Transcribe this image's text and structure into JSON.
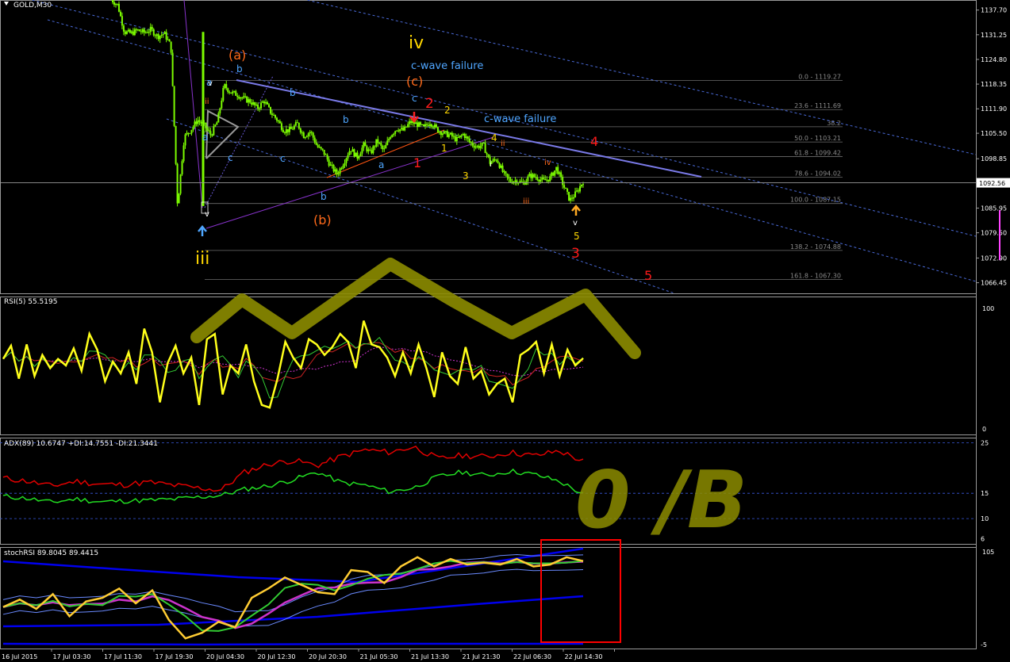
{
  "chart_title": "GOLD,M30",
  "colors": {
    "background": "#000000",
    "candles": "#7CFC00",
    "grid": "#1c3c5a",
    "separator": "#9a9a9a",
    "fib": "#6e6e6e",
    "wave_blue": "#4fa6ff",
    "wave_orange": "#ff6a1a",
    "wave_red": "#ff1a1a",
    "wave_yellow": "#ffd700",
    "channel": "#7a7ae8",
    "drawing_olive": "#8c8c00",
    "rsi": "#ffff1a",
    "adx_minus": "#e00000",
    "adx_plus": "#22dd22",
    "stoch_main": "#ffcc33",
    "stoch_signal": "#cc33cc",
    "box": "#ff0000"
  },
  "price_axis": {
    "ticks": [
      "1137.70",
      "1131.25",
      "1124.80",
      "1118.35",
      "1111.90",
      "1105.50",
      "1098.85",
      "1092.40",
      "1085.95",
      "1079.50",
      "1072.90",
      "1066.45"
    ],
    "current_price": "1092.56"
  },
  "fib_levels": [
    {
      "label": "0.0 - 1119.27"
    },
    {
      "label": "23.6 - 1111.69"
    },
    {
      "label": "38.2"
    },
    {
      "label": "50.0 - 1103.21"
    },
    {
      "label": "61.8 - 1099.42"
    },
    {
      "label": "78.6 - 1094.02"
    },
    {
      "label": "100.0 - 1087.15"
    },
    {
      "label": "138.2 - 1074.88"
    },
    {
      "label": "161.8 - 1067.30"
    }
  ],
  "wave_labels": [
    {
      "text": "iv",
      "color": "yellow",
      "size": 22
    },
    {
      "text": "iii",
      "color": "yellow",
      "size": 22
    },
    {
      "text": "(a)",
      "color": "orange",
      "size": 16
    },
    {
      "text": "(b)",
      "color": "orange",
      "size": 16
    },
    {
      "text": "(c)",
      "color": "orange",
      "size": 16
    },
    {
      "text": "c-wave failure",
      "color": "blue",
      "size": 13
    },
    {
      "text": "c-wave failure",
      "color": "blue",
      "size": 13
    },
    {
      "text": "a",
      "color": "blue",
      "size": 12
    },
    {
      "text": "b",
      "color": "blue",
      "size": 12
    },
    {
      "text": "c",
      "color": "blue",
      "size": 12
    },
    {
      "text": "a",
      "color": "blue",
      "size": 12
    },
    {
      "text": "b",
      "color": "blue",
      "size": 12
    },
    {
      "text": "c",
      "color": "blue",
      "size": 12
    },
    {
      "text": "b",
      "color": "blue",
      "size": 12
    },
    {
      "text": "a",
      "color": "blue",
      "size": 12
    },
    {
      "text": "b",
      "color": "blue",
      "size": 12
    },
    {
      "text": "c",
      "color": "blue",
      "size": 12
    },
    {
      "text": "1",
      "color": "red",
      "size": 16
    },
    {
      "text": "2",
      "color": "red",
      "size": 17
    },
    {
      "text": "3",
      "color": "red",
      "size": 17
    },
    {
      "text": "4",
      "color": "red",
      "size": 16
    },
    {
      "text": "5",
      "color": "red",
      "size": 16
    },
    {
      "text": "1",
      "color": "yellow",
      "size": 12
    },
    {
      "text": "2",
      "color": "yellow",
      "size": 12
    },
    {
      "text": "3",
      "color": "yellow",
      "size": 12
    },
    {
      "text": "4",
      "color": "yellow",
      "size": 12
    },
    {
      "text": "5",
      "color": "yellow",
      "size": 12
    },
    {
      "text": "i",
      "color": "white",
      "size": 10
    },
    {
      "text": "ii",
      "color": "orange",
      "size": 10
    },
    {
      "text": "iii",
      "color": "orange",
      "size": 10
    },
    {
      "text": "iv",
      "color": "orange",
      "size": 10
    },
    {
      "text": "v",
      "color": "white",
      "size": 10
    },
    {
      "text": "v",
      "color": "white",
      "size": 10
    },
    {
      "text": "ii",
      "color": "orange",
      "size": 10
    },
    {
      "text": "v",
      "color": "white",
      "size": 10
    }
  ],
  "rsi": {
    "label": "RSI(5) 55.5195",
    "ticks": [
      "100",
      "0"
    ]
  },
  "adx": {
    "label": "ADX(89) 10.6747 +DI:14.7551 -DI:21.3441",
    "ticks": [
      "25",
      "15",
      "10",
      "6"
    ]
  },
  "stoch": {
    "label": "stochRSI 89.8045 89.4415",
    "ticks": [
      "105",
      "-5"
    ]
  },
  "handwritten_text": "0 /B",
  "time_axis": [
    "16 Jul 2015",
    "17 Jul 03:30",
    "17 Jul 11:30",
    "17 Jul 19:30",
    "20 Jul 04:30",
    "20 Jul 12:30",
    "20 Jul 20:30",
    "21 Jul 05:30",
    "21 Jul 13:30",
    "21 Jul 21:30",
    "22 Jul 06:30",
    "22 Jul 14:30"
  ],
  "chart_data": [
    {
      "type": "candlestick",
      "title": "GOLD,M30",
      "ylim": [
        1064.5,
        1139.5
      ],
      "x_ticks": [
        "16 Jul 2015",
        "17 Jul 03:30",
        "17 Jul 11:30",
        "17 Jul 19:30",
        "20 Jul 04:30",
        "20 Jul 12:30",
        "20 Jul 20:30",
        "21 Jul 05:30",
        "21 Jul 13:30",
        "21 Jul 21:30",
        "22 Jul 06:30",
        "22 Jul 14:30"
      ],
      "close_path": [
        1140.5,
        1139.0,
        1132.0,
        1131.6,
        1132.4,
        1131.8,
        1132.6,
        1130.8,
        1131.6,
        1128.2,
        1086.5,
        1104.5,
        1106.4,
        1109.0,
        1107.5,
        1105.0,
        1108.6,
        1118.0,
        1116.2,
        1115.6,
        1114.5,
        1113.8,
        1112.0,
        1114.0,
        1111.0,
        1109.0,
        1106.2,
        1106.4,
        1108.0,
        1104.8,
        1106.0,
        1102.0,
        1100.5,
        1097.0,
        1094.8,
        1098.0,
        1101.5,
        1099.2,
        1102.4,
        1100.2,
        1103.6,
        1100.8,
        1105.0,
        1106.8,
        1106.2,
        1108.5,
        1107.9,
        1106.9,
        1108.5,
        1106.5,
        1105.5,
        1105.0,
        1103.8,
        1105.3,
        1103.0,
        1102.0,
        1102.4,
        1097.8,
        1098.8,
        1095.0,
        1093.0,
        1093.2,
        1092.4,
        1094.5,
        1094.0,
        1093.0,
        1093.8,
        1096.5,
        1092.0,
        1088.0,
        1090.0,
        1093.0
      ],
      "current_price": 1092.56,
      "fib_levels": [
        1119.27,
        1111.69,
        1107.2,
        1103.21,
        1099.42,
        1094.02,
        1087.15,
        1074.88,
        1067.3
      ]
    },
    {
      "type": "line",
      "title": "RSI(5) 55.5195",
      "ylim": [
        0,
        100
      ],
      "series": [
        {
          "values": [
            55,
            65,
            40,
            66,
            42,
            58,
            48,
            55,
            50,
            63,
            46,
            74,
            62,
            38,
            53,
            44,
            60,
            36,
            78,
            60,
            22,
            52,
            65,
            44,
            56,
            20,
            70,
            74,
            28,
            50,
            44,
            66,
            38,
            20,
            18,
            40,
            68,
            56,
            48,
            70,
            66,
            58,
            64,
            74,
            68,
            48,
            84,
            66,
            64,
            56,
            42,
            60,
            44,
            66,
            48,
            26,
            60,
            42,
            36,
            64,
            40,
            46,
            28,
            36,
            40,
            22,
            58,
            62,
            68,
            44,
            66,
            42,
            62,
            50,
            55.5
          ]
        }
      ]
    },
    {
      "type": "line",
      "title": "ADX(89) 10.6747 +DI:14.7551 -DI:21.3441",
      "ylim": [
        5,
        26
      ],
      "series": [
        {
          "name": "-DI",
          "values": [
            18.0,
            17.4,
            16.4,
            17.4,
            16.8,
            16.7,
            17.2,
            16.6,
            16.1,
            15.6,
            19.2,
            20.8,
            21.5,
            20.5,
            22.3,
            23.6,
            23.1,
            24.2,
            21.8,
            22.5,
            22.2,
            23.1,
            22.4,
            23.4,
            21.3
          ]
        },
        {
          "name": "+DI",
          "values": [
            14.4,
            14.0,
            13.2,
            13.9,
            13.3,
            13.5,
            13.6,
            13.8,
            14.2,
            14.6,
            15.8,
            16.5,
            17.7,
            19.2,
            17.1,
            16.6,
            15.3,
            16.1,
            18.3,
            19.2,
            18.5,
            19.4,
            18.7,
            17.4,
            14.8
          ]
        },
        {
          "name": "ADX",
          "values": [
            10.7
          ]
        }
      ]
    },
    {
      "type": "line",
      "title": "stochRSI 89.8045 89.4415",
      "ylim": [
        -5,
        105
      ],
      "series": [
        {
          "values": [
            40,
            48,
            38,
            54,
            30,
            46,
            50,
            60,
            44,
            58,
            26,
            6,
            12,
            24,
            18,
            50,
            60,
            72,
            64,
            56,
            54,
            80,
            78,
            66,
            84,
            94,
            84,
            92,
            86,
            88,
            86,
            92,
            84,
            86,
            94,
            89.8
          ]
        }
      ]
    }
  ]
}
